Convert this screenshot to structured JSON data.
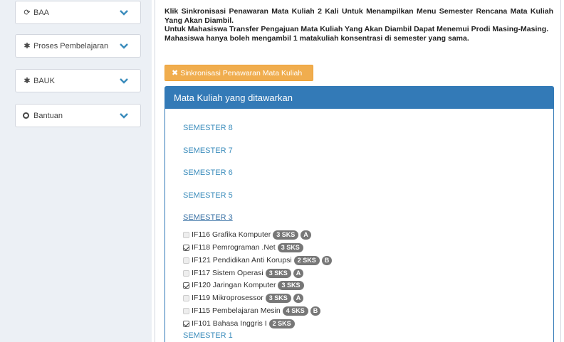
{
  "sidebar": {
    "items": [
      {
        "icon": "refresh-icon",
        "glyph": "⟳",
        "label": "BAA"
      },
      {
        "icon": "gear-icon",
        "glyph": "✱",
        "label": "Proses Pembelajaran"
      },
      {
        "icon": "gear-icon",
        "glyph": "✱",
        "label": "BAUK"
      },
      {
        "icon": "circle-icon",
        "glyph": "",
        "label": "Bantuan"
      }
    ]
  },
  "notice": {
    "line1": "Klik Sinkronisasi Penawaran Mata Kuliah 2 Kali Untuk Menampilkan Menu Semester Rencana Mata Kuliah Yang Akan Diambil.",
    "line2": "Untuk Mahasiswa Transfer Pengajuan Mata Kuliah Yang Akan Diambil Dapat Menemui Prodi Masing-Masing.",
    "line3": "Mahasiswa hanya boleh mengambil 1 matakuliah konsentrasi di semester yang sama."
  },
  "sync_button": {
    "icon": "x-icon",
    "glyph": "✖",
    "label": "Sinkronisasi Penawaran Mata Kuliah"
  },
  "panel": {
    "title": "Mata Kuliah yang ditawarkan",
    "semesters": [
      "SEMESTER 8",
      "SEMESTER 7",
      "SEMESTER 6",
      "SEMESTER 5",
      "SEMESTER 3"
    ],
    "courses": [
      {
        "label": "IF116 Grafika Komputer",
        "sks": "3 SKS",
        "group": "A",
        "checked": false
      },
      {
        "label": "IF118 Pemrograman .Net",
        "sks": "3 SKS",
        "group": "",
        "checked": true
      },
      {
        "label": "IF121 Pendidikan Anti Korupsi",
        "sks": "2 SKS",
        "group": "B",
        "checked": false
      },
      {
        "label": "IF117 Sistem Operasi",
        "sks": "3 SKS",
        "group": "A",
        "checked": false
      },
      {
        "label": "IF120 Jaringan Komputer",
        "sks": "3 SKS",
        "group": "",
        "checked": true
      },
      {
        "label": "IF119 Mikroprosessor",
        "sks": "3 SKS",
        "group": "A",
        "checked": false
      },
      {
        "label": "IF115 Pembelajaran Mesin",
        "sks": "4 SKS",
        "group": "B",
        "checked": false
      },
      {
        "label": "IF101 Bahasa Inggris I",
        "sks": "2 SKS",
        "group": "",
        "checked": true
      }
    ],
    "next_semester": "SEMESTER 1"
  },
  "colors": {
    "primary": "#337ab7",
    "warning": "#f0ad4e",
    "link": "#3c8dbc",
    "badge": "#777777"
  }
}
